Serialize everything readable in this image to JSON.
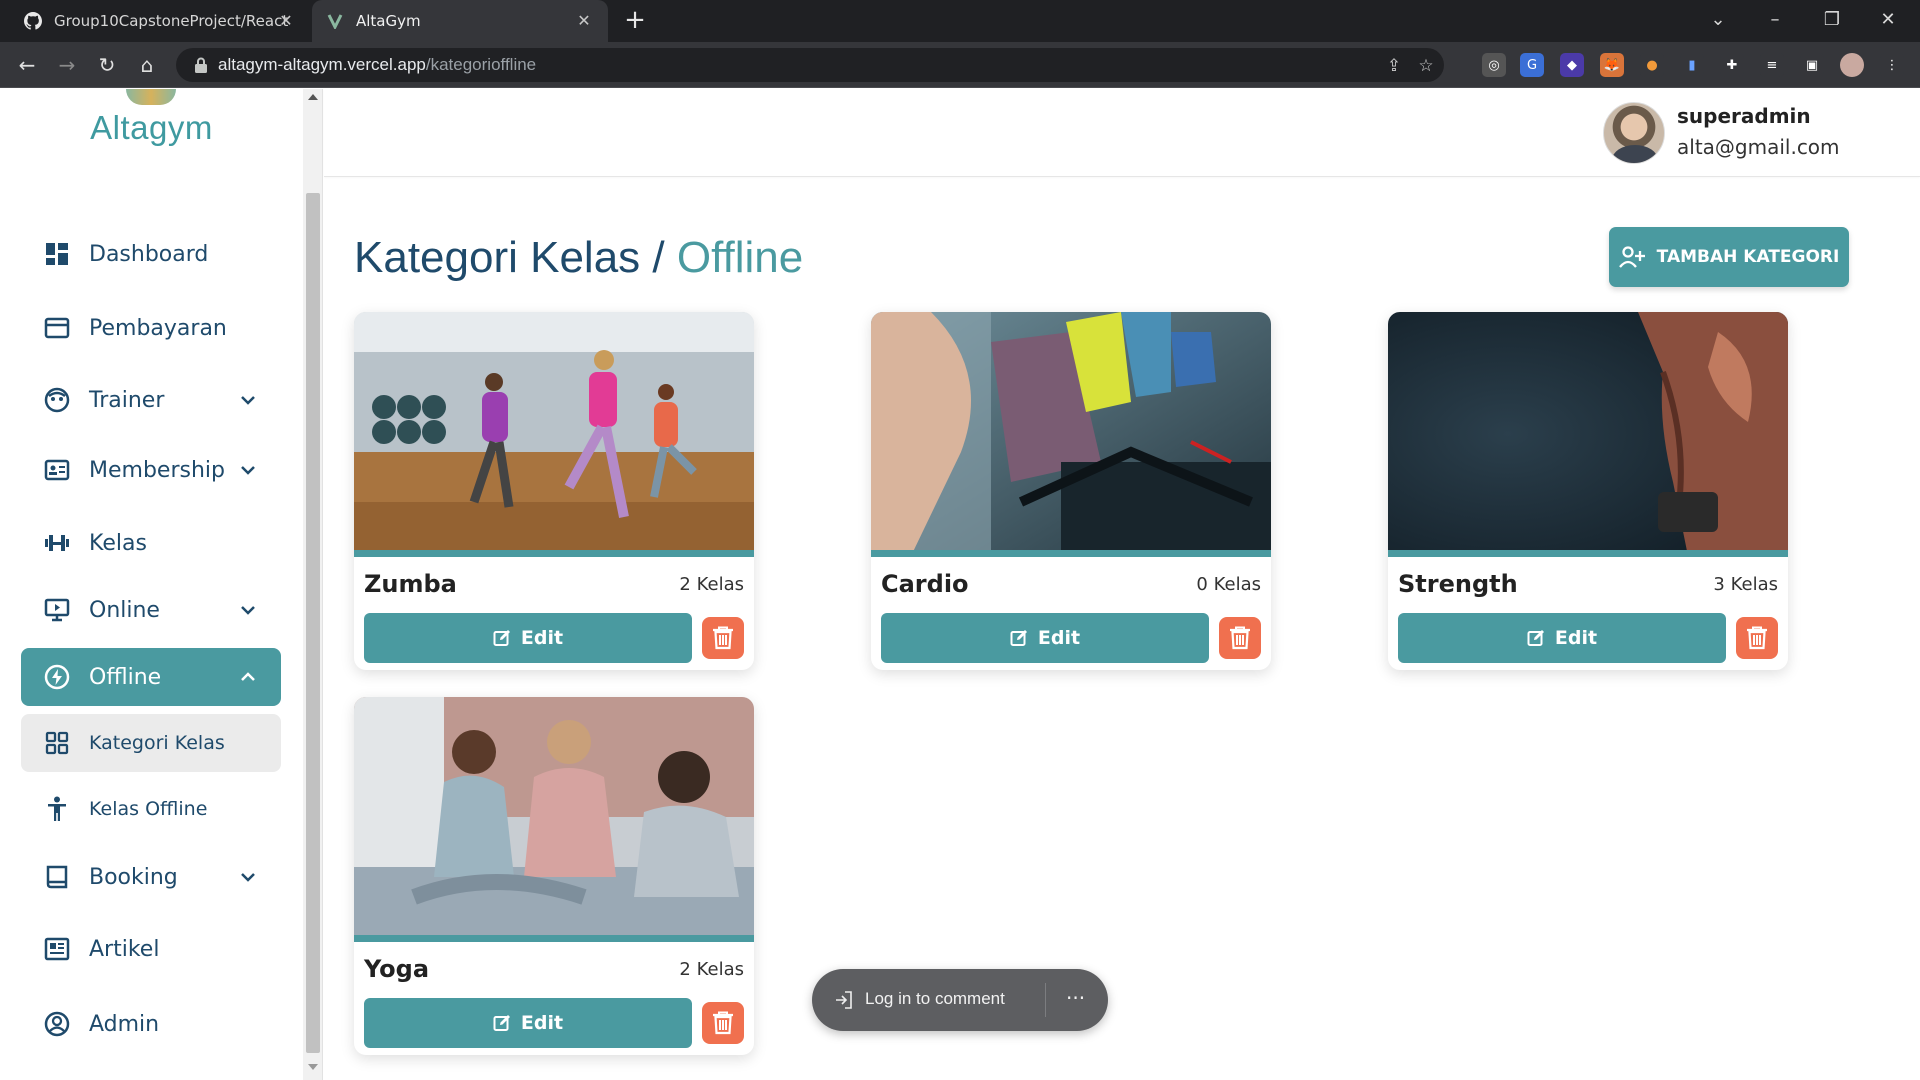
{
  "browser": {
    "tabs": [
      {
        "title": "Group10CapstoneProject/React",
        "icon": "github-icon"
      },
      {
        "title": "AltaGym",
        "icon": "altagym-favicon"
      }
    ],
    "url_domain": "altagym-altagym.vercel.app",
    "url_path": "/kategorioffline"
  },
  "sidebar": {
    "logo": "Altagym",
    "items": [
      {
        "label": "Dashboard",
        "icon": "dashboard-icon"
      },
      {
        "label": "Pembayaran",
        "icon": "wallet-icon"
      },
      {
        "label": "Trainer",
        "icon": "face-icon",
        "expandable": true
      },
      {
        "label": "Membership",
        "icon": "id-card-icon",
        "expandable": true
      },
      {
        "label": "Kelas",
        "icon": "dumbbell-icon"
      },
      {
        "label": "Online",
        "icon": "monitor-icon",
        "expandable": true
      },
      {
        "label": "Offline",
        "icon": "bolt-circle-icon",
        "expandable": true,
        "active": true
      },
      {
        "label": "Kategori Kelas",
        "icon": "grid-icon",
        "sub": true,
        "selected": true
      },
      {
        "label": "Kelas Offline",
        "icon": "person-icon",
        "sub": true
      },
      {
        "label": "Booking",
        "icon": "book-icon",
        "expandable": true
      },
      {
        "label": "Artikel",
        "icon": "newspaper-icon"
      },
      {
        "label": "Admin",
        "icon": "user-circle-icon"
      }
    ]
  },
  "header": {
    "username": "superadmin",
    "email": "alta@gmail.com"
  },
  "page": {
    "title_main": "Kategori Kelas",
    "title_sep": "/",
    "title_accent": "Offline",
    "add_button": "TAMBAH KATEGORI"
  },
  "categories": [
    {
      "name": "Zumba",
      "count": "2 Kelas",
      "edit_label": "Edit"
    },
    {
      "name": "Cardio",
      "count": "0 Kelas",
      "edit_label": "Edit"
    },
    {
      "name": "Strength",
      "count": "3 Kelas",
      "edit_label": "Edit"
    },
    {
      "name": "Yoga",
      "count": "2 Kelas",
      "edit_label": "Edit"
    }
  ],
  "comment_widget": {
    "label": "Log in to comment",
    "more": "···"
  },
  "colors": {
    "accent": "#4a9aa0",
    "navy": "#1f4a6b",
    "danger": "#f0704f"
  }
}
